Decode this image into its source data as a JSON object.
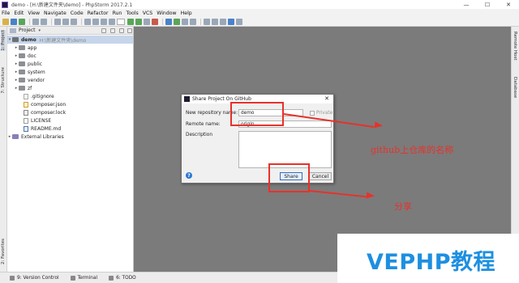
{
  "window": {
    "title": "demo - [H:\\新建文件夹\\demo] - PhpStorm 2017.2.1",
    "controls": [
      "—",
      "☐",
      "✕"
    ]
  },
  "menu": [
    "File",
    "Edit",
    "View",
    "Navigate",
    "Code",
    "Refactor",
    "Run",
    "Tools",
    "VCS",
    "Window",
    "Help"
  ],
  "left_tabs": [
    "1: Project",
    "7: Structure",
    "2: Favorites"
  ],
  "right_tabs": [
    "Remote Host",
    "Database"
  ],
  "project_panel": {
    "label": "Project",
    "dropdown": "▾"
  },
  "tree": {
    "root": {
      "name": "demo",
      "path": "H:\\新建文件夹\\demo"
    },
    "folders": [
      "app",
      "doc",
      "public",
      "system",
      "vendor",
      "zf"
    ],
    "files": [
      ".gitignore",
      "composer.json",
      "composer.lock",
      "LICENSE",
      "README.md"
    ],
    "external": "External Libraries"
  },
  "statusbar": [
    "9: Version Control",
    "Terminal",
    "6: TODO"
  ],
  "dialog": {
    "title": "Share Project On GitHub",
    "close": "✕",
    "repo_label": "New repository name:",
    "repo_value": "demo",
    "private_label": "Private",
    "remote_label": "Remote name:",
    "remote_value": "origin",
    "description_label": "Description",
    "help": "?",
    "share": "Share",
    "cancel": "Cancel"
  },
  "annotations": {
    "repo_note": "github上仓库的名称",
    "share_note": "分享",
    "color": "#e8312a"
  },
  "watermark": "VEPHP教程"
}
